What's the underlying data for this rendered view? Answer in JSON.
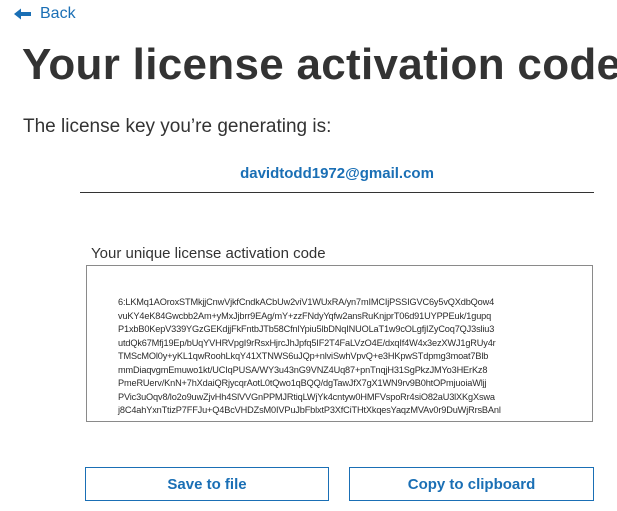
{
  "nav": {
    "back_label": "Back",
    "back_icon": "arrow-left-icon"
  },
  "header": {
    "title": "Your license activation code"
  },
  "license": {
    "intro": "The license key you’re generating is:",
    "email": "davidtodd1972@gmail.com",
    "code_label": "Your unique license activation code",
    "code_lines": [
      "6:LKMq1AOroxSTMkjjCnwVjkfCndkACbUw2viV1WUxRA/yn7mIMCIjPSSIGVC6y5vQXdbQow4",
      "vuKY4eK84Gwcbb2Am+yMxJjbrr9EAg/mY+zzFNdyYqfw2ansRuKnjprT06d91UYPPEuk/1gupq",
      "P1xbB0KepV339YGzGEKdjjFkFntbJTb58CfnlYpiu5lbDNqINUOLaT1w9cOLgfjIZyCoq7QJ3sliu3",
      "utdQk67Mfj19Ep/bUqYVHRVpgI9rRsxHjrcJhJpfq5IF2T4FaLVzO4E/dxqIf4W4x3ezXWJ1gRUy4r",
      "TMScMOl0y+yKL1qwRoohLkqY41XTNWS6uJQp+nlviSwhVpvQ+e3HKpwSTdpmg3moat7Blb",
      "mmDiaqvgmEmuwo1kt/UCIqPUSA/WY3u43nG9VNZ4Uq87+pnTnqjH31SgPkzJMYo3HErKz8",
      "PmeRUerv/KnN+7hXdaiQRjycqrAotL0tQwo1qBQQ/dgTawJfX7gX1WN9rv9B0htOPmjuoiaWljj",
      "PVic3uOqv8/lo2o9uwZjvHh4SlVVGnPPMJRtiqLWjYk4cntyw0HMFVspoRr4siO82aU3lXKgXswa",
      "j8C4ahYxnTtizP7FFJu+Q4BcVHDZsM0IVPuJbFblxtP3XfCiTHtXkqesYaqzMVAv0r9DuWjRrsBAnl"
    ]
  },
  "actions": {
    "save_label": "Save to file",
    "copy_label": "Copy to clipboard"
  },
  "colors": {
    "accent": "#1a6fb5",
    "text": "#333333",
    "border": "#8a8a8a"
  }
}
